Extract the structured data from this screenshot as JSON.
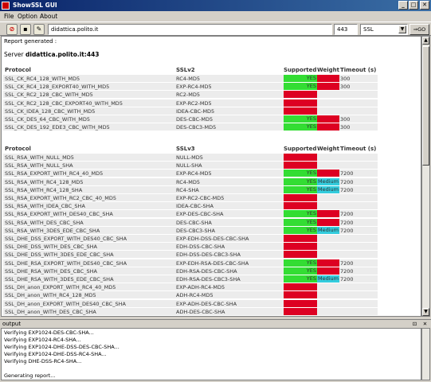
{
  "window": {
    "title": "ShowSSL GUI",
    "min": "_",
    "max": "□",
    "close": "✕"
  },
  "menu": {
    "items": [
      "File",
      "Option",
      "About"
    ]
  },
  "toolbar": {
    "host_value": "didattica.polito.it",
    "port_value": "443",
    "protocol_value": "SSL",
    "go_label": "GO"
  },
  "report": {
    "generated_label": "Report generated :",
    "server_label": "Server",
    "server_value": "didattica.polito.it:443"
  },
  "colors": {
    "supported": "#33dd33",
    "unsupported": "#dd0022",
    "medium": "#33ccdd"
  },
  "tables": [
    {
      "headers": [
        "Protocol",
        "SSLv2",
        "Supported",
        "Weight",
        "Timeout (s)"
      ],
      "rows": [
        {
          "protocol": "SSL_CK_RC4_128_WITH_MD5",
          "cipher": "RC4-MD5",
          "supported": "YES",
          "weight": "",
          "weight_class": "red",
          "timeout": "300"
        },
        {
          "protocol": "SSL_CK_RC4_128_EXPORT40_WITH_MD5",
          "cipher": "EXP-RC4-MD5",
          "supported": "YES",
          "weight": "",
          "weight_class": "red",
          "timeout": "300"
        },
        {
          "protocol": "SSL_CK_RC2_128_CBC_WITH_MD5",
          "cipher": "RC2-MD5",
          "supported": "",
          "weight": "",
          "weight_class": "none",
          "timeout": ""
        },
        {
          "protocol": "SSL_CK_RC2_128_CBC_EXPORT40_WITH_MD5",
          "cipher": "EXP-RC2-MD5",
          "supported": "",
          "weight": "",
          "weight_class": "none",
          "timeout": ""
        },
        {
          "protocol": "SSL_CK_IDEA_128_CBC_WITH_MD5",
          "cipher": "IDEA-CBC-MD5",
          "supported": "",
          "weight": "",
          "weight_class": "none",
          "timeout": ""
        },
        {
          "protocol": "SSL_CK_DES_64_CBC_WITH_MD5",
          "cipher": "DES-CBC-MD5",
          "supported": "YES",
          "weight": "",
          "weight_class": "red",
          "timeout": "300"
        },
        {
          "protocol": "SSL_CK_DES_192_EDE3_CBC_WITH_MD5",
          "cipher": "DES-CBC3-MD5",
          "supported": "YES",
          "weight": "",
          "weight_class": "red",
          "timeout": "300"
        }
      ]
    },
    {
      "headers": [
        "Protocol",
        "SSLv3",
        "Supported",
        "Weight",
        "Timeout (s)"
      ],
      "rows": [
        {
          "protocol": "SSL_RSA_WITH_NULL_MD5",
          "cipher": "NULL-MD5",
          "supported": "",
          "weight": "",
          "weight_class": "none",
          "timeout": ""
        },
        {
          "protocol": "SSL_RSA_WITH_NULL_SHA",
          "cipher": "NULL-SHA",
          "supported": "",
          "weight": "",
          "weight_class": "none",
          "timeout": ""
        },
        {
          "protocol": "SSL_RSA_EXPORT_WITH_RC4_40_MD5",
          "cipher": "EXP-RC4-MD5",
          "supported": "YES",
          "weight": "",
          "weight_class": "red",
          "timeout": "7200"
        },
        {
          "protocol": "SSL_RSA_WITH_RC4_128_MD5",
          "cipher": "RC4-MD5",
          "supported": "YES",
          "weight": "Medium",
          "weight_class": "medium",
          "timeout": "7200"
        },
        {
          "protocol": "SSL_RSA_WITH_RC4_128_SHA",
          "cipher": "RC4-SHA",
          "supported": "YES",
          "weight": "Medium",
          "weight_class": "medium",
          "timeout": "7200"
        },
        {
          "protocol": "SSL_RSA_EXPORT_WITH_RC2_CBC_40_MD5",
          "cipher": "EXP-RC2-CBC-MD5",
          "supported": "",
          "weight": "",
          "weight_class": "none",
          "timeout": ""
        },
        {
          "protocol": "SSL_RSA_WITH_IDEA_CBC_SHA",
          "cipher": "IDEA-CBC-SHA",
          "supported": "",
          "weight": "",
          "weight_class": "none",
          "timeout": ""
        },
        {
          "protocol": "SSL_RSA_EXPORT_WITH_DES40_CBC_SHA",
          "cipher": "EXP-DES-CBC-SHA",
          "supported": "YES",
          "weight": "",
          "weight_class": "red",
          "timeout": "7200"
        },
        {
          "protocol": "SSL_RSA_WITH_DES_CBC_SHA",
          "cipher": "DES-CBC-SHA",
          "supported": "YES",
          "weight": "",
          "weight_class": "red",
          "timeout": "7200"
        },
        {
          "protocol": "SSL_RSA_WITH_3DES_EDE_CBC_SHA",
          "cipher": "DES-CBC3-SHA",
          "supported": "YES",
          "weight": "Medium",
          "weight_class": "medium",
          "timeout": "7200"
        },
        {
          "protocol": "SSL_DHE_DSS_EXPORT_WITH_DES40_CBC_SHA",
          "cipher": "EXP-EDH-DSS-DES-CBC-SHA",
          "supported": "",
          "weight": "",
          "weight_class": "none",
          "timeout": ""
        },
        {
          "protocol": "SSL_DHE_DSS_WITH_DES_CBC_SHA",
          "cipher": "EDH-DSS-CBC-SHA",
          "supported": "",
          "weight": "",
          "weight_class": "none",
          "timeout": ""
        },
        {
          "protocol": "SSL_DHE_DSS_WITH_3DES_EDE_CBC_SHA",
          "cipher": "EDH-DSS-DES-CBC3-SHA",
          "supported": "",
          "weight": "",
          "weight_class": "none",
          "timeout": ""
        },
        {
          "protocol": "SSL_DHE_RSA_EXPORT_WITH_DES40_CBC_SHA",
          "cipher": "EXP-EDH-RSA-DES-CBC-SHA",
          "supported": "YES",
          "weight": "",
          "weight_class": "red",
          "timeout": "7200"
        },
        {
          "protocol": "SSL_DHE_RSA_WITH_DES_CBC_SHA",
          "cipher": "EDH-RSA-DES-CBC-SHA",
          "supported": "YES",
          "weight": "",
          "weight_class": "red",
          "timeout": "7200"
        },
        {
          "protocol": "SSL_DHE_RSA_WITH_3DES_EDE_CBC_SHA",
          "cipher": "EDH-RSA-DES-CBC3-SHA",
          "supported": "YES",
          "weight": "Medium",
          "weight_class": "medium",
          "timeout": "7200"
        },
        {
          "protocol": "SSL_DH_anon_EXPORT_WITH_RC4_40_MD5",
          "cipher": "EXP-ADH-RC4-MD5",
          "supported": "",
          "weight": "",
          "weight_class": "none",
          "timeout": ""
        },
        {
          "protocol": "SSL_DH_anon_WITH_RC4_128_MD5",
          "cipher": "ADH-RC4-MD5",
          "supported": "",
          "weight": "",
          "weight_class": "none",
          "timeout": ""
        },
        {
          "protocol": "SSL_DH_anon_EXPORT_WITH_DES40_CBC_SHA",
          "cipher": "EXP-ADH-DES-CBC-SHA",
          "supported": "",
          "weight": "",
          "weight_class": "none",
          "timeout": ""
        },
        {
          "protocol": "SSL_DH_anon_WITH_DES_CBC_SHA",
          "cipher": "ADH-DES-CBC-SHA",
          "supported": "",
          "weight": "",
          "weight_class": "none",
          "timeout": ""
        }
      ]
    }
  ],
  "output": {
    "title": "output",
    "pin": "⊡",
    "close": "✕",
    "lines": [
      "Verifying EXP1024-DES-CBC-SHA...",
      "Verifying EXP1024-RC4-SHA...",
      "Verifying EXP1024-DHE-DSS-DES-CBC-SHA...",
      "Verifying EXP1024-DHE-DSS-RC4-SHA...",
      "Verifying DHE-DSS-RC4-SHA...",
      "",
      "Generating report..."
    ]
  }
}
